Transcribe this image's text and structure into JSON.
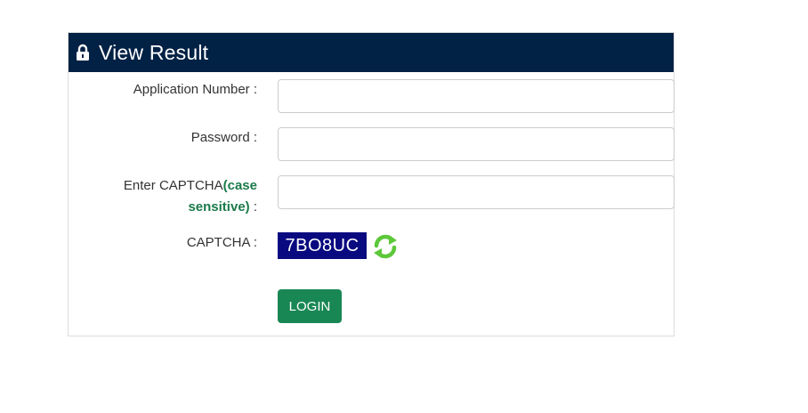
{
  "header": {
    "title": "View Result",
    "icon": "lock-icon"
  },
  "form": {
    "application_number": {
      "label": "Application Number :",
      "value": "",
      "placeholder": ""
    },
    "password": {
      "label": "Password :",
      "value": "",
      "placeholder": ""
    },
    "captcha_input": {
      "label_prefix": "Enter CAPTCHA",
      "label_emphasis": "(case sensitive)",
      "label_suffix": " :",
      "value": "",
      "placeholder": ""
    },
    "captcha": {
      "label": "CAPTCHA :",
      "code": "7BO8UC",
      "refresh_icon": "refresh-icon"
    },
    "login_label": "LOGIN"
  },
  "colors": {
    "header_bg": "#012145",
    "captcha_bg": "#090a80",
    "button_bg": "#198754",
    "emphasis": "#1b7a4a",
    "refresh_green": "#5cc83a"
  }
}
